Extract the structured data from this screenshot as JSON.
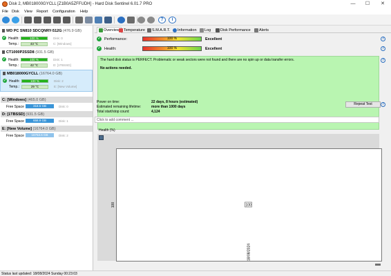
{
  "window": {
    "title": "Disk 2, MB018000GYCLL [Z1B0A5ZFFUDH] -  Hard Disk Sentinel 6.01.7 PRO",
    "minimize": "—",
    "maximize": "☐",
    "close": "✕"
  },
  "menu": [
    "File",
    "Disk",
    "View",
    "Report",
    "Configuration",
    "Help"
  ],
  "toolbar": {
    "icons": [
      "refresh-icon",
      "refresh-all-icon",
      "hdd-icon",
      "hdd-icon",
      "hdd-icon",
      "hdd-icon",
      "hdd-icon",
      "hdd-icon",
      "printer-icon",
      "report-icon",
      "monitor-icon",
      "settings-icon",
      "settings-icon",
      "help-icon",
      "info-icon"
    ]
  },
  "disks": [
    {
      "name": "WD PC SN810 SDCQNRY-512G",
      "size": "(476.9 GB)",
      "health_label": "Health:",
      "health": "100 %",
      "health_value": 100,
      "temp_label": "Temp.:",
      "temp": "43 °C",
      "disk_no": "Disk: 0",
      "volume": "C: [Windows]"
    },
    {
      "name": "CT1000P2SSD8",
      "size": "(931.5 GB)",
      "health_label": "Health:",
      "health": "100 %",
      "health_value": 100,
      "temp_label": "Temp.:",
      "temp": "42 °C",
      "disk_no": "Disk: 1",
      "volume": "D: [1TBSSD]"
    },
    {
      "name": "MB018000GYCLL",
      "size": "(16764.0 GB)",
      "health_label": "Health:",
      "health": "100 %",
      "health_value": 100,
      "temp_label": "Temp.:",
      "temp": "29 °C",
      "disk_no": "Disk: 2",
      "volume": "E: [New Volume]"
    }
  ],
  "volumes": [
    {
      "name": "C: [Windows]",
      "size": "(465.0 GB)",
      "free_label": "Free Space",
      "free": "318.5 GB",
      "disk_no": "Disk: 0"
    },
    {
      "name": "D: [1TBSSD]",
      "size": "(931.5 GB)",
      "free_label": "Free Space",
      "free": "658.9 GB",
      "disk_no": "Disk: 1"
    },
    {
      "name": "E: [New Volume]",
      "size": "(16764.0 GB)",
      "free_label": "Free Space",
      "free": "16763.6 GB",
      "disk_no": "Disk: 2"
    }
  ],
  "tabs": [
    {
      "label": "Overview",
      "icon": "overview-icon",
      "active": true
    },
    {
      "label": "Temperature",
      "icon": "thermometer-icon",
      "active": false
    },
    {
      "label": "S.M.A.R.T.",
      "icon": "smart-icon",
      "active": false
    },
    {
      "label": "Information",
      "icon": "info-icon",
      "active": false
    },
    {
      "label": "Log",
      "icon": "log-icon",
      "active": false
    },
    {
      "label": "Disk Performance",
      "icon": "performance-icon",
      "active": false
    },
    {
      "label": "Alerts",
      "icon": "alerts-icon",
      "active": false
    }
  ],
  "overview": {
    "performance_label": "Performance:",
    "performance": "100 %",
    "performance_value": 100,
    "performance_rating": "Excellent",
    "health_label": "Health:",
    "health": "100 %",
    "health_value": 100,
    "health_rating": "Excellent",
    "status_text": "The hard disk status is PERFECT. Problematic or weak sectors were not found and there are no spin up or data transfer errors.",
    "status_action": "No actions needed.",
    "power_on_label": "Power on time:",
    "power_on": "22 days, 8 hours (estimated)",
    "lifetime_label": "Estimated remaining lifetime:",
    "lifetime": "more than 1000 days",
    "startstop_label": "Total start/stop count:",
    "startstop": "4,124",
    "repeat_test": "Repeat Test",
    "comment_placeholder": "Click to add comment ..."
  },
  "chart_data": {
    "type": "line",
    "title": "Health (%)",
    "x": [
      "18/08/2024"
    ],
    "series": [
      {
        "values": [
          100
        ]
      }
    ],
    "ylabel": "",
    "xlabel": "",
    "data_labels": [
      "100"
    ],
    "ytick_labels": [
      "100"
    ]
  },
  "statusbar": {
    "text": "Status last updated: 18/08/2024 Sunday 00:23:03"
  },
  "colors": {
    "health_bar": "#22b418",
    "status_ok": "#b9f5b1",
    "free_space_bar": "#3a95d8",
    "accent": "#2b6fc1"
  }
}
